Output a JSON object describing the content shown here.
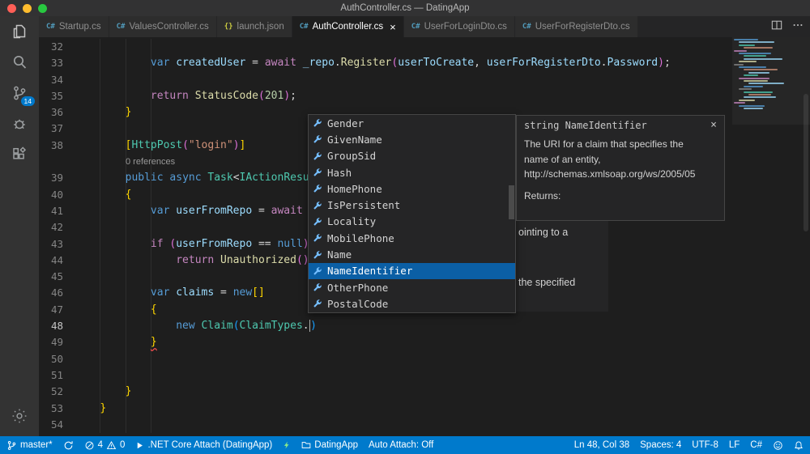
{
  "window": {
    "title": "AuthController.cs — DatingApp"
  },
  "colors": {
    "accent": "#007acc",
    "suggest_selection": "#0b5fa5",
    "error": "#f14c4c",
    "badge": "#007acc"
  },
  "tabs": [
    {
      "label": "Startup.cs",
      "icon": "C#",
      "icon_color": "#519aba",
      "active": false
    },
    {
      "label": "ValuesController.cs",
      "icon": "C#",
      "icon_color": "#519aba",
      "active": false
    },
    {
      "label": "launch.json",
      "icon": "{}",
      "icon_color": "#cbcb41",
      "active": false
    },
    {
      "label": "AuthController.cs",
      "icon": "C#",
      "icon_color": "#519aba",
      "active": true
    },
    {
      "label": "UserForLoginDto.cs",
      "icon": "C#",
      "icon_color": "#519aba",
      "active": false
    },
    {
      "label": "UserForRegisterDto.cs",
      "icon": "C#",
      "icon_color": "#519aba",
      "active": false
    }
  ],
  "activity_bar": {
    "scm_badge": "14"
  },
  "editor": {
    "rows": [
      {
        "num": "32",
        "segs": []
      },
      {
        "num": "33",
        "segs": [
          {
            "t": "            ",
            "c": "pln"
          },
          {
            "t": "var",
            "c": "kw"
          },
          {
            "t": " ",
            "c": "pln"
          },
          {
            "t": "createdUser",
            "c": "var"
          },
          {
            "t": " = ",
            "c": "pln"
          },
          {
            "t": "await",
            "c": "ctrl"
          },
          {
            "t": " ",
            "c": "pln"
          },
          {
            "t": "_repo",
            "c": "var"
          },
          {
            "t": ".",
            "c": "pln"
          },
          {
            "t": "Register",
            "c": "fn"
          },
          {
            "t": "(",
            "c": "b2"
          },
          {
            "t": "userToCreate",
            "c": "var"
          },
          {
            "t": ", ",
            "c": "pln"
          },
          {
            "t": "userForRegisterDto",
            "c": "var"
          },
          {
            "t": ".",
            "c": "pln"
          },
          {
            "t": "Password",
            "c": "var"
          },
          {
            "t": ")",
            "c": "b2"
          },
          {
            "t": ";",
            "c": "pln"
          }
        ]
      },
      {
        "num": "34",
        "segs": []
      },
      {
        "num": "35",
        "segs": [
          {
            "t": "            ",
            "c": "pln"
          },
          {
            "t": "return",
            "c": "ctrl"
          },
          {
            "t": " ",
            "c": "pln"
          },
          {
            "t": "StatusCode",
            "c": "fn"
          },
          {
            "t": "(",
            "c": "b2"
          },
          {
            "t": "201",
            "c": "num"
          },
          {
            "t": ")",
            "c": "b2"
          },
          {
            "t": ";",
            "c": "pln"
          }
        ]
      },
      {
        "num": "36",
        "segs": [
          {
            "t": "        ",
            "c": "pln"
          },
          {
            "t": "}",
            "c": "b1"
          }
        ]
      },
      {
        "num": "37",
        "segs": []
      },
      {
        "num": "38",
        "segs": [
          {
            "t": "        ",
            "c": "pln"
          },
          {
            "t": "[",
            "c": "b1"
          },
          {
            "t": "HttpPost",
            "c": "type"
          },
          {
            "t": "(",
            "c": "b2"
          },
          {
            "t": "\"login\"",
            "c": "str"
          },
          {
            "t": ")",
            "c": "b2"
          },
          {
            "t": "]",
            "c": "b1"
          }
        ]
      },
      {
        "lens": "0 references"
      },
      {
        "num": "39",
        "segs": [
          {
            "t": "        ",
            "c": "pln"
          },
          {
            "t": "public",
            "c": "kw"
          },
          {
            "t": " ",
            "c": "pln"
          },
          {
            "t": "async",
            "c": "kw"
          },
          {
            "t": " ",
            "c": "pln"
          },
          {
            "t": "Task",
            "c": "type"
          },
          {
            "t": "<",
            "c": "pln"
          },
          {
            "t": "IActionResu",
            "c": "type"
          }
        ]
      },
      {
        "num": "40",
        "segs": [
          {
            "t": "        ",
            "c": "pln"
          },
          {
            "t": "{",
            "c": "b1"
          }
        ]
      },
      {
        "num": "41",
        "segs": [
          {
            "t": "            ",
            "c": "pln"
          },
          {
            "t": "var",
            "c": "kw"
          },
          {
            "t": " ",
            "c": "pln"
          },
          {
            "t": "userFromRepo",
            "c": "var"
          },
          {
            "t": " = ",
            "c": "pln"
          },
          {
            "t": "await",
            "c": "ctrl"
          }
        ]
      },
      {
        "num": "42",
        "segs": []
      },
      {
        "num": "43",
        "segs": [
          {
            "t": "            ",
            "c": "pln"
          },
          {
            "t": "if",
            "c": "ctrl"
          },
          {
            "t": " ",
            "c": "pln"
          },
          {
            "t": "(",
            "c": "b2"
          },
          {
            "t": "userFromRepo",
            "c": "var"
          },
          {
            "t": " == ",
            "c": "pln"
          },
          {
            "t": "null",
            "c": "kw"
          },
          {
            "t": ")",
            "c": "b2"
          }
        ]
      },
      {
        "num": "44",
        "segs": [
          {
            "t": "                ",
            "c": "pln"
          },
          {
            "t": "return",
            "c": "ctrl"
          },
          {
            "t": " ",
            "c": "pln"
          },
          {
            "t": "Unauthorized",
            "c": "fn"
          },
          {
            "t": "()",
            "c": "b2"
          }
        ]
      },
      {
        "num": "45",
        "segs": []
      },
      {
        "num": "46",
        "segs": [
          {
            "t": "            ",
            "c": "pln"
          },
          {
            "t": "var",
            "c": "kw"
          },
          {
            "t": " ",
            "c": "pln"
          },
          {
            "t": "claims",
            "c": "var"
          },
          {
            "t": " = ",
            "c": "pln"
          },
          {
            "t": "new",
            "c": "kw"
          },
          {
            "t": "[]",
            "c": "b1"
          }
        ]
      },
      {
        "num": "47",
        "segs": [
          {
            "t": "            ",
            "c": "pln"
          },
          {
            "t": "{",
            "c": "b1"
          }
        ]
      },
      {
        "num": "48",
        "active": true,
        "segs": [
          {
            "t": "                ",
            "c": "pln"
          },
          {
            "t": "new",
            "c": "kw"
          },
          {
            "t": " ",
            "c": "pln"
          },
          {
            "t": "Claim",
            "c": "type"
          },
          {
            "t": "(",
            "c": "b3"
          },
          {
            "t": "ClaimTypes",
            "c": "type"
          },
          {
            "t": ".",
            "c": "pln"
          },
          {
            "cursor": true
          },
          {
            "t": ")",
            "c": "b3"
          }
        ]
      },
      {
        "num": "49",
        "segs": [
          {
            "t": "            ",
            "c": "pln"
          },
          {
            "t": "}",
            "c": "b1 err"
          }
        ]
      },
      {
        "num": "50",
        "segs": []
      },
      {
        "num": "51",
        "segs": []
      },
      {
        "num": "52",
        "segs": [
          {
            "t": "        ",
            "c": "pln"
          },
          {
            "t": "}",
            "c": "b1"
          }
        ]
      },
      {
        "num": "53",
        "segs": [
          {
            "t": "    ",
            "c": "pln"
          },
          {
            "t": "}",
            "c": "b1"
          }
        ]
      },
      {
        "num": "54",
        "segs": []
      }
    ]
  },
  "suggest": {
    "items": [
      "Gender",
      "GivenName",
      "GroupSid",
      "Hash",
      "HomePhone",
      "IsPersistent",
      "Locality",
      "MobilePhone",
      "Name",
      "NameIdentifier",
      "OtherPhone",
      "PostalCode"
    ],
    "selected_index": 9
  },
  "docs": {
    "signature": "string NameIdentifier",
    "close": "×",
    "body_lines": [
      "The URI for a claim that specifies the",
      "name of an entity,",
      "http://schemas.xmlsoap.org/ws/2005/05"
    ],
    "returns_label": "Returns:",
    "clipped_fragments": [
      "ointing to a",
      "the specified"
    ]
  },
  "status_bar": {
    "branch": "master*",
    "errors": "4",
    "warnings": "0",
    "debug_config": ".NET Core Attach (DatingApp)",
    "project": "DatingApp",
    "auto_attach": "Auto Attach: Off",
    "cursor_position": "Ln 48, Col 38",
    "indentation": "Spaces: 4",
    "encoding": "UTF-8",
    "eol": "LF",
    "language": "C#"
  }
}
